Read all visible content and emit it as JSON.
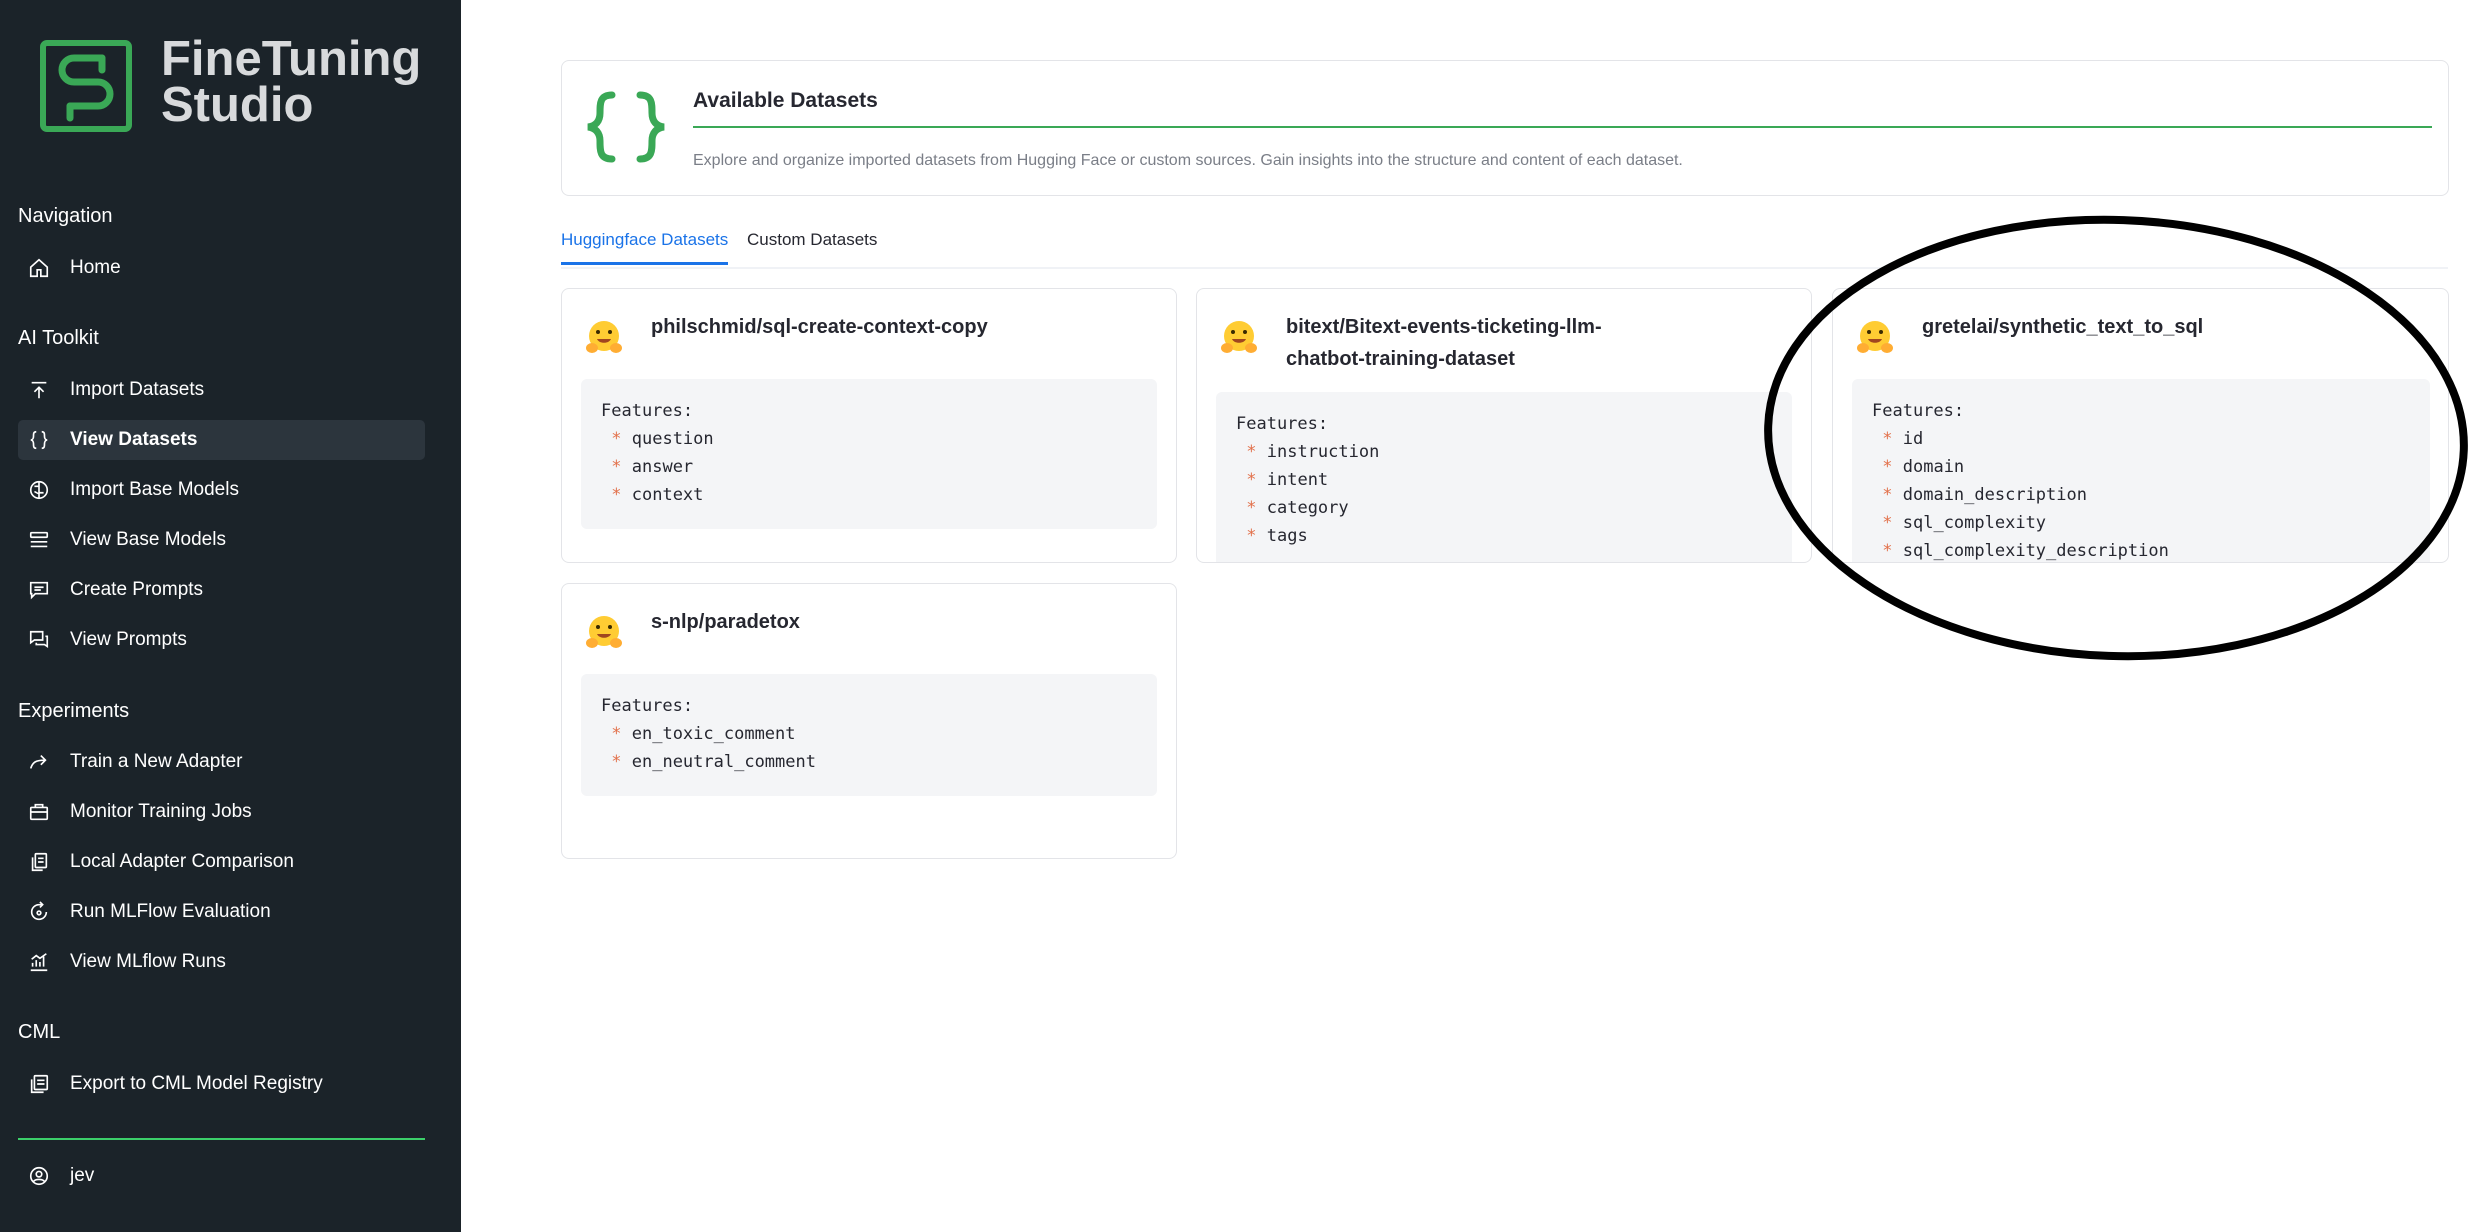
{
  "brand": {
    "line1": "FineTuning",
    "line2": "Studio",
    "accent_color": "#3aa856"
  },
  "sidebar": {
    "sections": [
      {
        "title": "Navigation",
        "items": [
          {
            "label": "Home",
            "icon": "home-icon"
          }
        ]
      },
      {
        "title": "AI Toolkit",
        "items": [
          {
            "label": "Import Datasets",
            "icon": "upload-icon"
          },
          {
            "label": "View Datasets",
            "icon": "braces-icon",
            "active": true
          },
          {
            "label": "Import Base Models",
            "icon": "brain-icon"
          },
          {
            "label": "View Base Models",
            "icon": "layers-icon"
          },
          {
            "label": "Create Prompts",
            "icon": "chat-icon"
          },
          {
            "label": "View Prompts",
            "icon": "chats-icon"
          }
        ]
      },
      {
        "title": "Experiments",
        "items": [
          {
            "label": "Train a New Adapter",
            "icon": "forward-icon"
          },
          {
            "label": "Monitor Training Jobs",
            "icon": "briefcase-icon"
          },
          {
            "label": "Local Adapter Comparison",
            "icon": "copy-icon"
          },
          {
            "label": "Run MLFlow Evaluation",
            "icon": "refresh-icon"
          },
          {
            "label": "View MLflow Runs",
            "icon": "chart-icon"
          }
        ]
      },
      {
        "title": "CML",
        "items": [
          {
            "label": "Export to CML Model Registry",
            "icon": "export-icon"
          }
        ]
      }
    ],
    "user": {
      "label": "jev",
      "icon": "user-icon"
    }
  },
  "header": {
    "title": "Available Datasets",
    "description": "Explore and organize imported datasets from Hugging Face or custom sources. Gain insights into the structure and content of each dataset."
  },
  "tabs": [
    {
      "label": "Huggingface Datasets",
      "active": true
    },
    {
      "label": "Custom Datasets",
      "active": false
    }
  ],
  "datasets": [
    {
      "name": "philschmid/sql-create-context-copy",
      "features_label": "Features:",
      "features": [
        "question",
        "answer",
        "context"
      ]
    },
    {
      "name_line1": "bitext/Bitext-events-ticketing-llm-",
      "name_line2": "chatbot-training-dataset",
      "features_label": "Features:",
      "features": [
        "instruction",
        "intent",
        "category",
        "tags"
      ]
    },
    {
      "name": "gretelai/synthetic_text_to_sql",
      "features_label": "Features:",
      "features": [
        "id",
        "domain",
        "domain_description",
        "sql_complexity",
        "sql_complexity_description"
      ]
    },
    {
      "name": "s-nlp/paradetox",
      "features_label": "Features:",
      "features": [
        "en_toxic_comment",
        "en_neutral_comment"
      ]
    }
  ]
}
